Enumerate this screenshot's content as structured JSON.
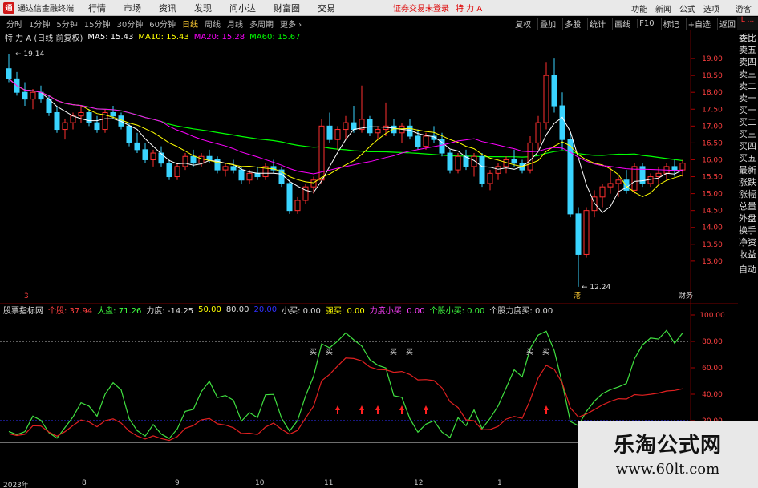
{
  "topbar": {
    "logo_text": "通",
    "app_name": "通达信金融终端",
    "menus": [
      "行情",
      "市场",
      "资讯",
      "发现",
      "问小达",
      "财富圈",
      "交易"
    ],
    "notice": "证券交易未登录",
    "stock_name": "特 力 A",
    "right_items": [
      "功能",
      "新闻",
      "公式",
      "选项"
    ],
    "guest": "游客"
  },
  "tabs": {
    "items": [
      "分时",
      "1分钟",
      "5分钟",
      "15分钟",
      "30分钟",
      "60分钟",
      "日线",
      "周线",
      "月线",
      "多周期",
      "更多 ›"
    ],
    "active": "日线"
  },
  "toolbar_right": [
    "复权",
    "叠加",
    "多股",
    "统计",
    "画线",
    "F10",
    "标记",
    "+自选",
    "返回"
  ],
  "corner": "L\n...",
  "ma_legend": {
    "stock": "特 力 A (日线 前复权)",
    "ma5": "MA5: 15.43",
    "ma10": "MA10: 15.43",
    "ma20": "MA20: 15.28",
    "ma60": "MA60: 15.67",
    "colors": {
      "ma5": "#ffffff",
      "ma10": "#ffff00",
      "ma20": "#ff00ff",
      "ma60": "#00ff00"
    }
  },
  "price_axis": {
    "labels": [
      "19.00",
      "18.50",
      "18.00",
      "17.50",
      "17.00",
      "16.50",
      "16.00",
      "15.50",
      "15.00",
      "14.50",
      "14.00",
      "13.50",
      "13.00"
    ],
    "high_label": "19.14",
    "low_label": "12.24"
  },
  "chart_markers": {
    "left_tag": "3",
    "bottom_tag": "港",
    "right_tag": "财务"
  },
  "indicator_legend": {
    "name": "股票指标网",
    "items": [
      {
        "label": "个股:",
        "value": "37.94",
        "color": "#ff4040"
      },
      {
        "label": "大盘:",
        "value": "71.26",
        "color": "#40ff40"
      },
      {
        "label": "力度:",
        "value": "-14.25",
        "color": "#dddddd"
      },
      {
        "label": "",
        "value": "50.00",
        "color": "#ffff00"
      },
      {
        "label": "",
        "value": "80.00",
        "color": "#dddddd"
      },
      {
        "label": "",
        "value": "20.00",
        "color": "#3030ff"
      },
      {
        "label": "小买:",
        "value": "0.00",
        "color": "#dddddd"
      },
      {
        "label": "强买:",
        "value": "0.00",
        "color": "#ffff00"
      },
      {
        "label": "力度小买:",
        "value": "0.00",
        "color": "#ff40ff"
      },
      {
        "label": "个股小买:",
        "value": "0.00",
        "color": "#40ff40"
      },
      {
        "label": "个股力度买:",
        "value": "0.00",
        "color": "#dddddd"
      }
    ]
  },
  "indicator_axis": [
    "100.00",
    "80.00",
    "60.00",
    "40.00",
    "20.00"
  ],
  "buy_labels": [
    "买",
    "买",
    "买",
    "买",
    "买",
    "买"
  ],
  "side_panel": {
    "items": [
      "委比",
      "卖五",
      "卖四",
      "卖三",
      "卖二",
      "卖一",
      "买一",
      "买二",
      "买三",
      "买四",
      "买五",
      "最新",
      "涨跌",
      "涨幅",
      "总量",
      "外盘",
      "换手",
      "净资",
      "收益"
    ],
    "bottom": "自动"
  },
  "date_axis": {
    "labels": [
      "2023年",
      "8",
      "9",
      "10",
      "11",
      "12",
      "1"
    ]
  },
  "watermark": {
    "title": "乐淘公式网",
    "url": "www.60lt.com"
  },
  "chart_data": {
    "type": "candlestick",
    "ylim": [
      12.0,
      19.5
    ],
    "indicator_ylim": [
      0,
      100
    ],
    "candles": [
      [
        18.7,
        19.14,
        18.3,
        18.4
      ],
      [
        18.4,
        18.6,
        17.9,
        18.0
      ],
      [
        18.0,
        18.3,
        17.6,
        17.8
      ],
      [
        17.8,
        18.1,
        17.5,
        18.0
      ],
      [
        18.0,
        18.2,
        17.7,
        17.8
      ],
      [
        17.8,
        17.9,
        17.3,
        17.4
      ],
      [
        17.4,
        17.6,
        16.8,
        16.9
      ],
      [
        16.9,
        17.2,
        16.6,
        17.1
      ],
      [
        17.1,
        17.4,
        16.9,
        17.3
      ],
      [
        17.3,
        17.6,
        17.1,
        17.4
      ],
      [
        17.4,
        17.5,
        17.0,
        17.1
      ],
      [
        17.1,
        17.3,
        16.8,
        16.9
      ],
      [
        16.9,
        17.5,
        16.8,
        17.4
      ],
      [
        17.4,
        17.6,
        17.2,
        17.3
      ],
      [
        17.3,
        17.4,
        16.9,
        17.0
      ],
      [
        17.0,
        17.1,
        16.4,
        16.5
      ],
      [
        16.5,
        16.8,
        16.2,
        16.3
      ],
      [
        16.3,
        16.5,
        15.9,
        16.0
      ],
      [
        16.0,
        16.3,
        15.8,
        16.2
      ],
      [
        16.2,
        16.4,
        15.8,
        15.9
      ],
      [
        15.9,
        16.0,
        15.4,
        15.5
      ],
      [
        15.5,
        15.9,
        15.4,
        15.8
      ],
      [
        15.8,
        16.2,
        15.7,
        16.1
      ],
      [
        16.1,
        16.3,
        15.8,
        15.9
      ],
      [
        15.9,
        16.2,
        15.8,
        16.1
      ],
      [
        16.1,
        16.3,
        15.9,
        16.0
      ],
      [
        16.0,
        16.1,
        15.6,
        15.7
      ],
      [
        15.7,
        15.9,
        15.5,
        15.8
      ],
      [
        15.8,
        16.0,
        15.6,
        15.7
      ],
      [
        15.7,
        15.8,
        15.3,
        15.4
      ],
      [
        15.4,
        15.7,
        15.3,
        15.6
      ],
      [
        15.6,
        15.8,
        15.4,
        15.5
      ],
      [
        15.5,
        15.9,
        15.4,
        15.8
      ],
      [
        15.8,
        16.0,
        15.6,
        15.7
      ],
      [
        15.7,
        15.8,
        15.2,
        15.3
      ],
      [
        15.3,
        15.4,
        14.4,
        14.5
      ],
      [
        14.5,
        14.9,
        14.4,
        14.8
      ],
      [
        14.8,
        15.3,
        14.7,
        15.2
      ],
      [
        15.2,
        15.5,
        15.0,
        15.4
      ],
      [
        15.4,
        17.2,
        15.3,
        17.0
      ],
      [
        17.0,
        17.4,
        16.5,
        16.6
      ],
      [
        16.6,
        17.0,
        16.3,
        16.9
      ],
      [
        16.9,
        17.3,
        16.6,
        17.1
      ],
      [
        17.1,
        17.6,
        16.8,
        16.9
      ],
      [
        16.9,
        18.2,
        16.8,
        17.2
      ],
      [
        17.2,
        17.3,
        16.7,
        16.8
      ],
      [
        16.8,
        17.0,
        16.6,
        16.9
      ],
      [
        16.9,
        17.7,
        16.7,
        17.0
      ],
      [
        17.0,
        17.2,
        16.7,
        16.8
      ],
      [
        16.8,
        17.1,
        16.5,
        17.0
      ],
      [
        17.0,
        17.2,
        16.6,
        16.7
      ],
      [
        16.7,
        16.9,
        16.3,
        16.4
      ],
      [
        16.4,
        16.8,
        16.3,
        16.7
      ],
      [
        16.7,
        17.0,
        16.5,
        16.6
      ],
      [
        16.6,
        16.8,
        16.1,
        16.2
      ],
      [
        16.2,
        16.3,
        15.6,
        15.7
      ],
      [
        15.7,
        16.2,
        15.6,
        16.1
      ],
      [
        16.1,
        16.3,
        15.7,
        15.8
      ],
      [
        15.8,
        16.2,
        15.5,
        16.1
      ],
      [
        16.1,
        16.2,
        15.2,
        15.3
      ],
      [
        15.3,
        15.7,
        15.1,
        15.6
      ],
      [
        15.6,
        15.9,
        15.4,
        15.8
      ],
      [
        15.8,
        16.1,
        15.6,
        16.0
      ],
      [
        16.0,
        16.3,
        15.8,
        15.9
      ],
      [
        15.9,
        16.0,
        15.6,
        15.7
      ],
      [
        15.7,
        16.7,
        15.6,
        16.5
      ],
      [
        16.5,
        17.3,
        16.3,
        17.1
      ],
      [
        17.1,
        18.9,
        16.9,
        18.5
      ],
      [
        18.5,
        19.0,
        17.4,
        17.6
      ],
      [
        17.6,
        18.0,
        16.3,
        16.6
      ],
      [
        16.6,
        16.8,
        14.3,
        14.4
      ],
      [
        14.4,
        14.6,
        12.24,
        13.2
      ],
      [
        13.2,
        14.6,
        13.1,
        14.5
      ],
      [
        14.5,
        15.1,
        14.3,
        14.9
      ],
      [
        14.9,
        15.3,
        14.6,
        15.2
      ],
      [
        15.2,
        15.8,
        15.0,
        15.3
      ],
      [
        15.3,
        15.5,
        14.9,
        15.4
      ],
      [
        15.4,
        15.7,
        15.0,
        15.1
      ],
      [
        15.1,
        15.9,
        15.0,
        15.8
      ],
      [
        15.8,
        15.9,
        15.2,
        15.3
      ],
      [
        15.3,
        15.6,
        15.2,
        15.5
      ],
      [
        15.5,
        15.8,
        15.3,
        15.6
      ],
      [
        15.6,
        15.9,
        15.4,
        15.8
      ],
      [
        15.8,
        16.0,
        15.5,
        15.7
      ],
      [
        15.7,
        16.0,
        15.5,
        15.9
      ]
    ]
  }
}
